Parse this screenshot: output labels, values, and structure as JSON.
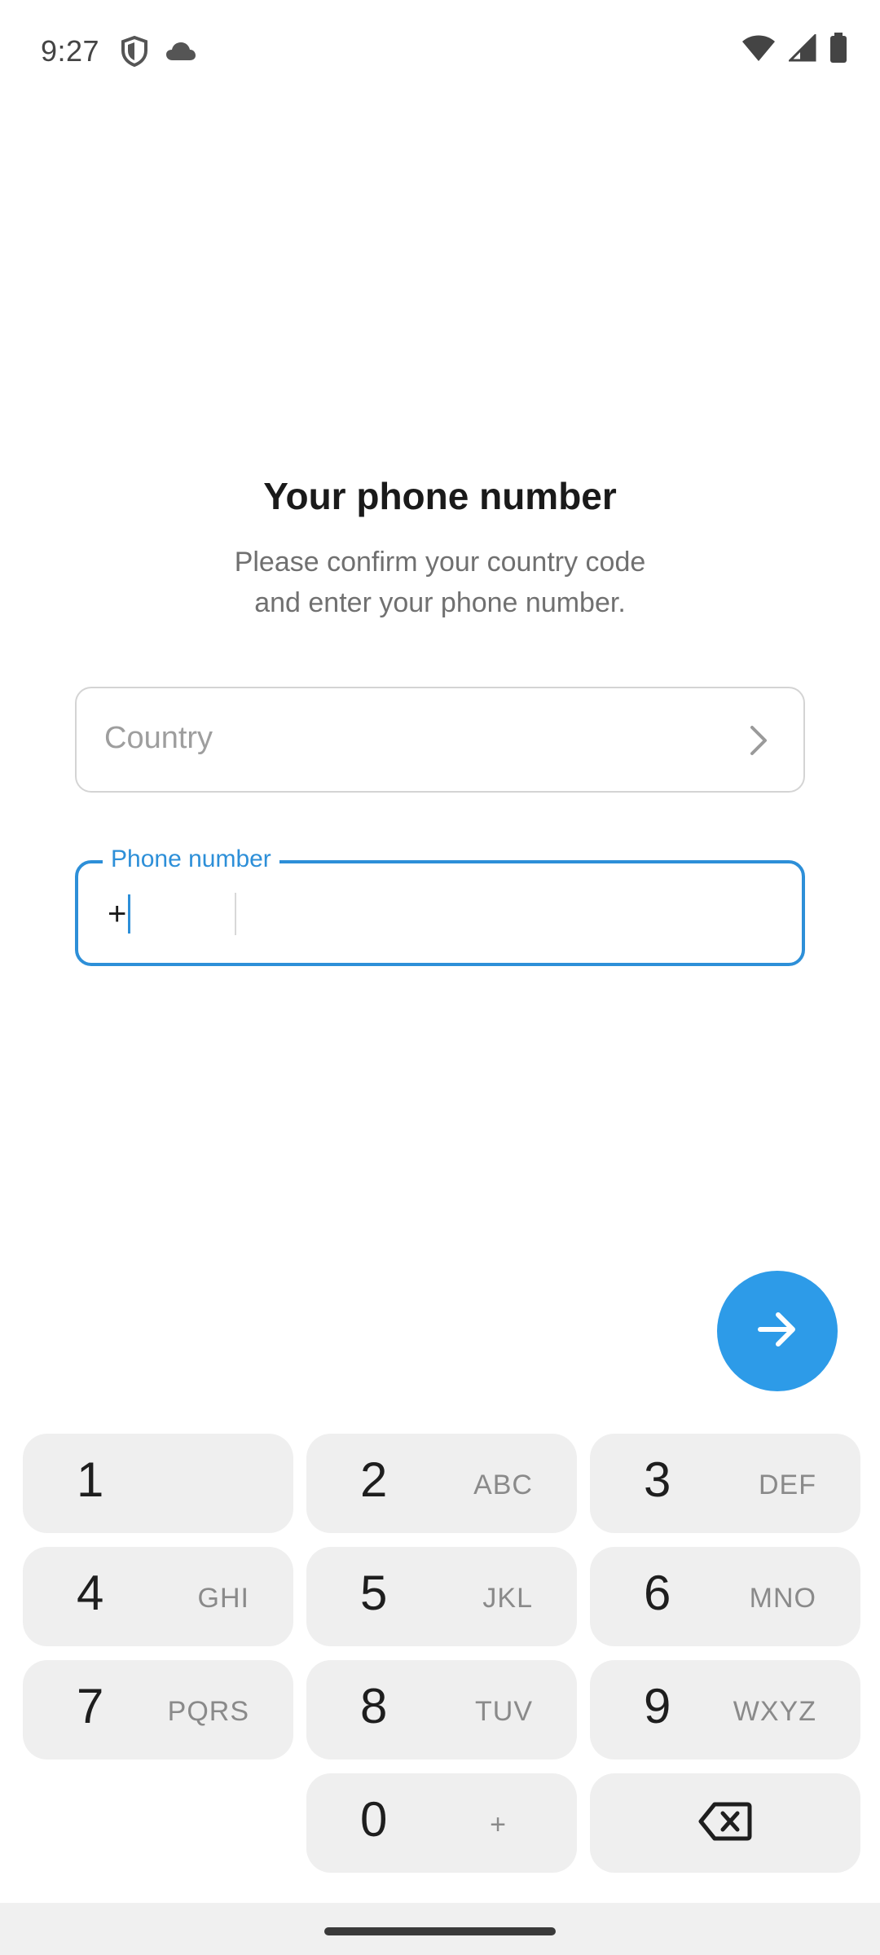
{
  "status_bar": {
    "time": "9:27",
    "icons": [
      "shield-icon",
      "cloud-icon",
      "wifi-icon",
      "signal-icon",
      "battery-icon"
    ]
  },
  "heading": {
    "title": "Your phone number",
    "subtitle_line1": "Please confirm your country code",
    "subtitle_line2": "and enter your phone number."
  },
  "country_field": {
    "placeholder": "Country",
    "icon": "chevron-right-icon"
  },
  "phone_field": {
    "label": "Phone number",
    "code_prefix": "+",
    "value": ""
  },
  "next_button": {
    "icon": "arrow-right-icon",
    "color": "#2d9be8"
  },
  "keypad": {
    "keys": [
      {
        "num": "1",
        "letters": ""
      },
      {
        "num": "2",
        "letters": "ABC"
      },
      {
        "num": "3",
        "letters": "DEF"
      },
      {
        "num": "4",
        "letters": "GHI"
      },
      {
        "num": "5",
        "letters": "JKL"
      },
      {
        "num": "6",
        "letters": "MNO"
      },
      {
        "num": "7",
        "letters": "PQRS"
      },
      {
        "num": "8",
        "letters": "TUV"
      },
      {
        "num": "9",
        "letters": "WXYZ"
      },
      {
        "num": "0",
        "letters": "+"
      }
    ],
    "backspace_icon": "backspace-icon"
  },
  "colors": {
    "accent": "#2d8fd8",
    "key_bg": "#efefef"
  }
}
